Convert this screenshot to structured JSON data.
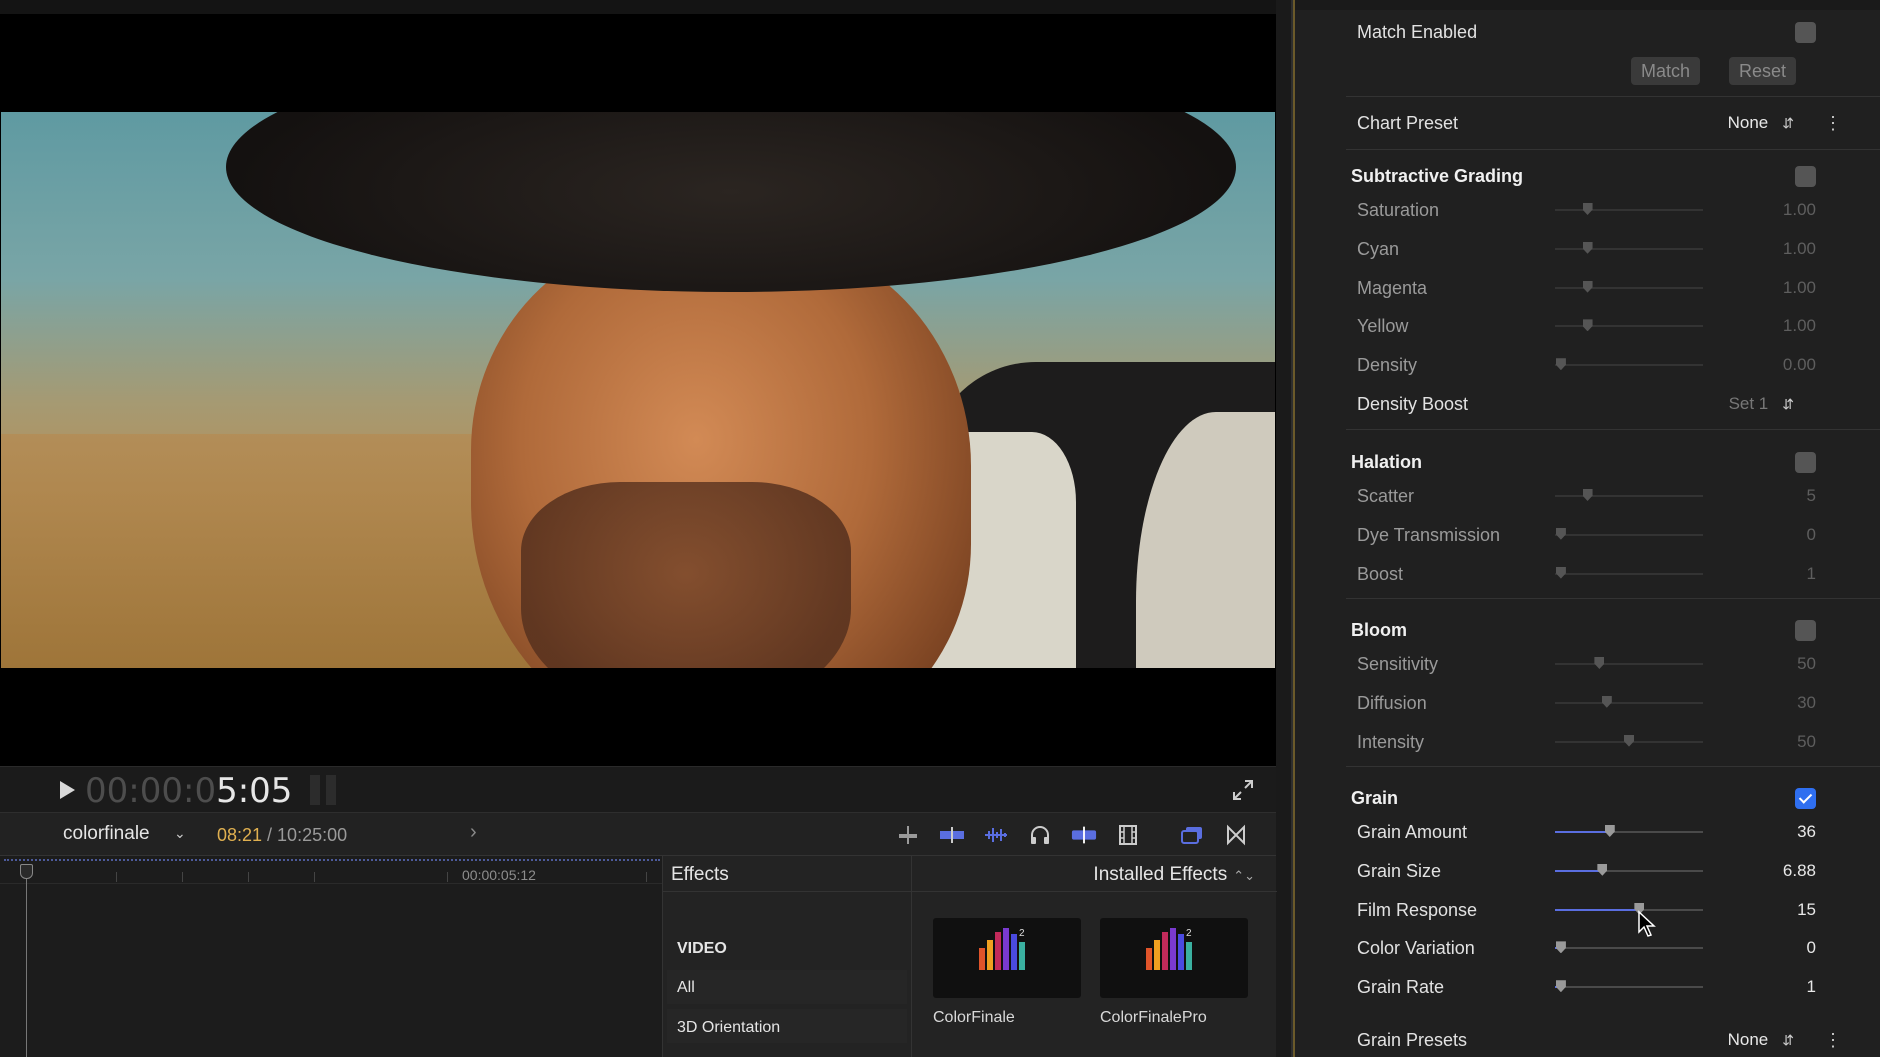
{
  "viewer": {
    "timecode_dim": "00:00:0",
    "timecode_bright": "5:05"
  },
  "timeline_bar": {
    "project_name": "colorfinale",
    "current_time": "08:21",
    "duration": " / 10:25:00",
    "ruler_label": "00:00:05:12"
  },
  "effects": {
    "title": "Effects",
    "installed_label": "Installed Effects",
    "category_header": "VIDEO",
    "categories": [
      "All",
      "3D Orientation"
    ],
    "tiles": [
      {
        "label": "ColorFinale",
        "icon": "colorfinale-icon"
      },
      {
        "label": "ColorFinalePro",
        "icon": "colorfinalepro-icon"
      }
    ]
  },
  "inspector": {
    "match_enabled_label": "Match Enabled",
    "match_button": "Match",
    "reset_button": "Reset",
    "chart_preset_label": "Chart Preset",
    "chart_preset_value": "None",
    "subtractive": {
      "title": "Subtractive Grading",
      "enabled": false,
      "params": [
        {
          "label": "Saturation",
          "value": "1.00",
          "pos": 0.22
        },
        {
          "label": "Cyan",
          "value": "1.00",
          "pos": 0.22
        },
        {
          "label": "Magenta",
          "value": "1.00",
          "pos": 0.22
        },
        {
          "label": "Yellow",
          "value": "1.00",
          "pos": 0.22
        },
        {
          "label": "Density",
          "value": "0.00",
          "pos": 0.04
        }
      ],
      "density_boost_label": "Density Boost",
      "density_boost_value": "Set 1"
    },
    "halation": {
      "title": "Halation",
      "enabled": false,
      "params": [
        {
          "label": "Scatter",
          "value": "5",
          "pos": 0.22
        },
        {
          "label": "Dye Transmission",
          "value": "0",
          "pos": 0.04
        },
        {
          "label": "Boost",
          "value": "1",
          "pos": 0.04
        }
      ]
    },
    "bloom": {
      "title": "Bloom",
      "enabled": false,
      "params": [
        {
          "label": "Sensitivity",
          "value": "50",
          "pos": 0.3
        },
        {
          "label": "Diffusion",
          "value": "30",
          "pos": 0.35
        },
        {
          "label": "Intensity",
          "value": "50",
          "pos": 0.5
        }
      ]
    },
    "grain": {
      "title": "Grain",
      "enabled": true,
      "params": [
        {
          "label": "Grain Amount",
          "value": "36",
          "pos": 0.37
        },
        {
          "label": "Grain Size",
          "value": "6.88",
          "pos": 0.32
        },
        {
          "label": "Film Response",
          "value": "15",
          "pos": 0.57
        },
        {
          "label": "Color Variation",
          "value": "0",
          "pos": 0.04
        },
        {
          "label": "Grain Rate",
          "value": "1",
          "pos": 0.04
        }
      ],
      "presets_label": "Grain Presets",
      "presets_value": "None"
    }
  },
  "colors": {
    "accent": "#2f6ff0",
    "timecode_current": "#e0b050"
  }
}
